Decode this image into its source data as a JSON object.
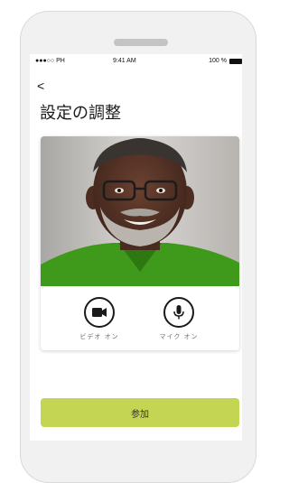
{
  "status_bar": {
    "carrier": "●●●○○ PH",
    "time": "9:41 AM",
    "battery": "100 %"
  },
  "nav": {
    "back_icon": "chevron-left-icon",
    "back_glyph": "<"
  },
  "page": {
    "title": "設定の調整"
  },
  "video_preview": {
    "description_icon": "participant-video-preview"
  },
  "controls": {
    "video": {
      "icon": "video-camera-icon",
      "label": "ビデオ オン"
    },
    "mic": {
      "icon": "microphone-icon",
      "label": "マイク オン"
    }
  },
  "join_button": {
    "label": "参加"
  },
  "colors": {
    "accent": "#c3d553",
    "shirt": "#3f9a1c",
    "background": "#f1f1f1"
  }
}
